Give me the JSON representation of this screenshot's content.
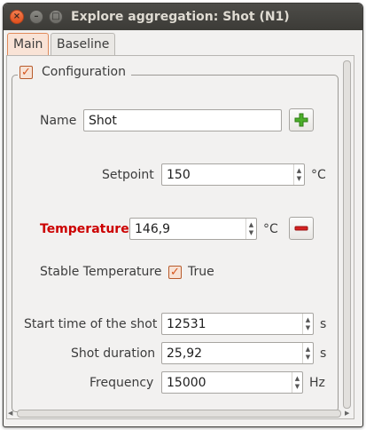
{
  "window": {
    "title": "Explore aggregation: Shot  (N1)",
    "close_glyph": "×",
    "min_glyph": "–",
    "max_glyph": "□"
  },
  "tabs": [
    {
      "label": "Main",
      "active": true
    },
    {
      "label": "Baseline",
      "active": false
    }
  ],
  "configuration": {
    "legend": "Configuration",
    "checked": true,
    "check_glyph": "✓"
  },
  "form": {
    "name": {
      "label": "Name",
      "value": "Shot"
    },
    "setpoint": {
      "label": "Setpoint",
      "value": "150",
      "unit": "°C"
    },
    "temperature": {
      "label": "Temperature",
      "value": "146,9",
      "unit": "°C",
      "label_color": "#cc0000"
    },
    "stable_temperature": {
      "label": "Stable Temperature",
      "checked": true,
      "value": "True"
    },
    "start_time": {
      "label": "Start time of the shot",
      "value": "12531",
      "unit": "s"
    },
    "shot_duration": {
      "label": "Shot duration",
      "value": "25,92",
      "unit": "s"
    },
    "frequency": {
      "label": "Frequency",
      "value": "15000",
      "unit": "Hz"
    }
  },
  "icons": {
    "plus": "plus-icon",
    "minus": "minus-icon",
    "spin_up": "▲",
    "spin_down": "▼"
  },
  "colors": {
    "accent": "#e05a1e",
    "plus_green": "#4caf2a",
    "minus_red": "#d62222",
    "title_bar": "#3c3b37"
  }
}
